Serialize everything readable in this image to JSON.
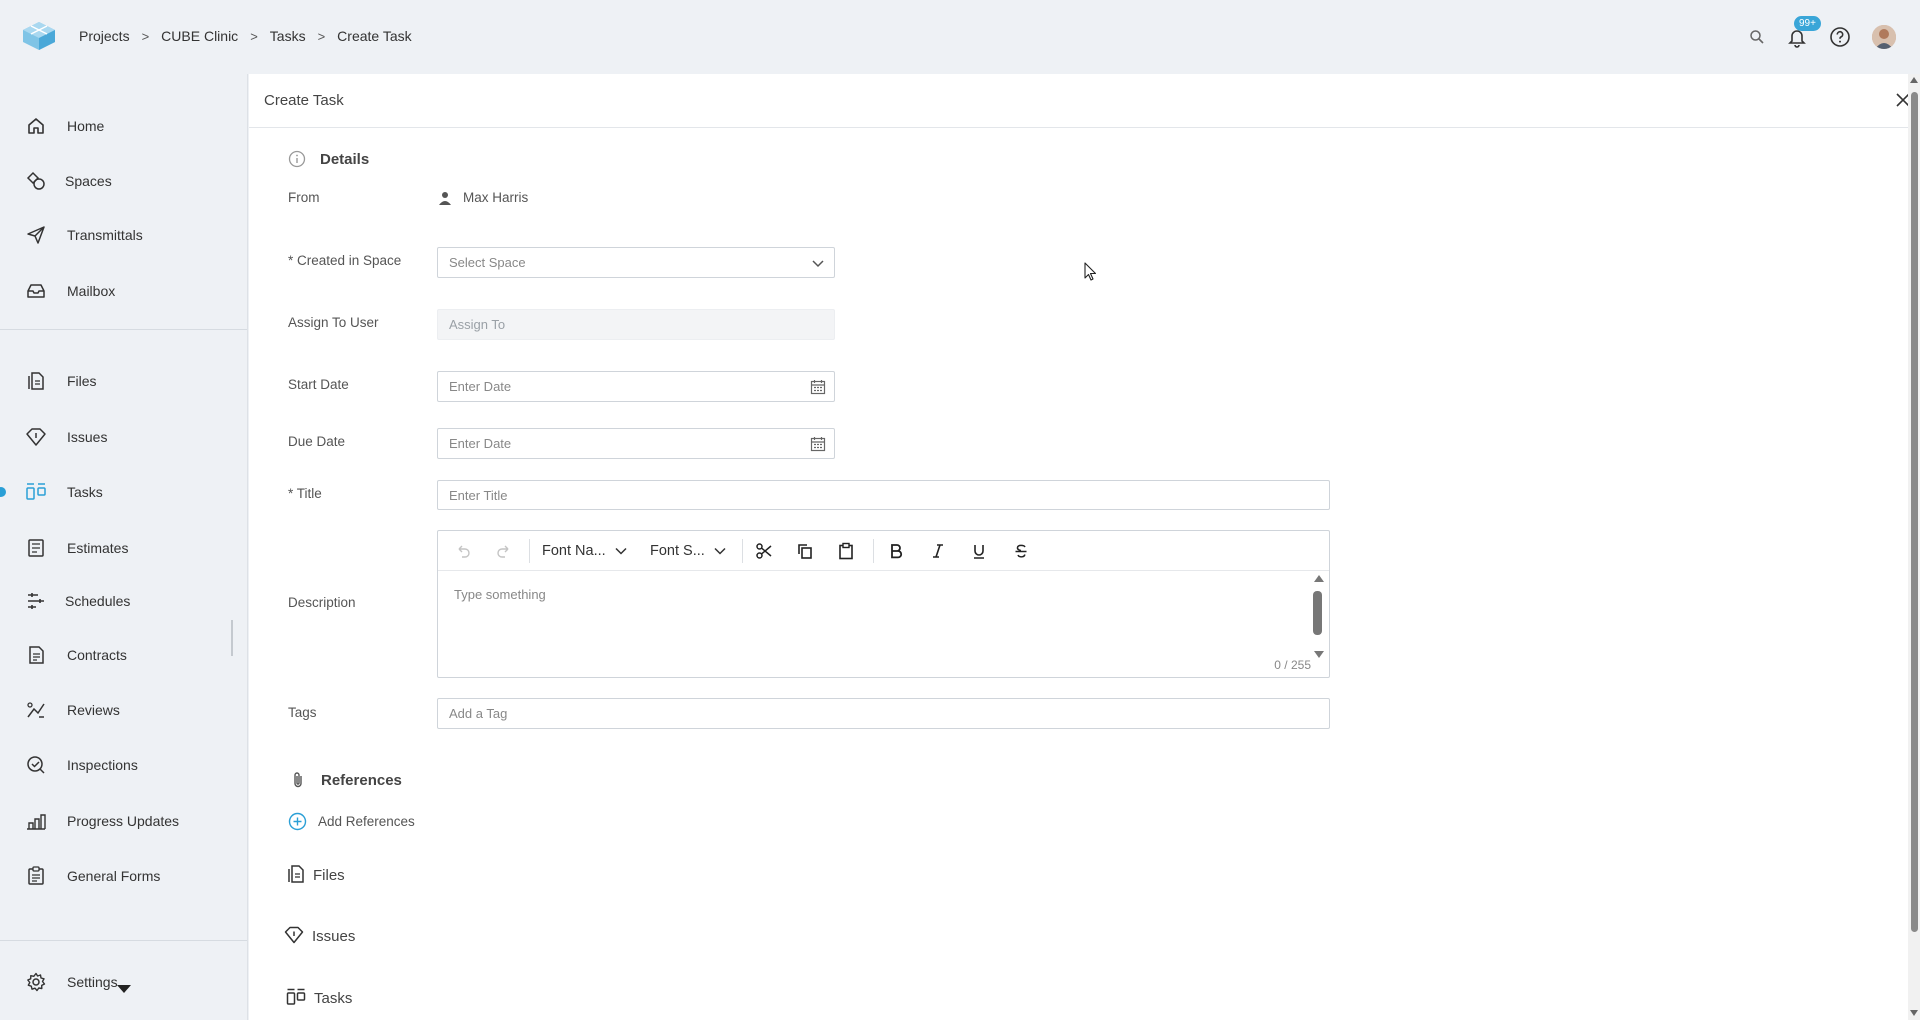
{
  "breadcrumb": [
    "Projects",
    "CUBE Clinic",
    "Tasks",
    "Create Task"
  ],
  "header": {
    "notification_badge": "99+",
    "icons": [
      "search-icon",
      "bell-icon",
      "help-icon",
      "avatar"
    ]
  },
  "sidebar": {
    "items": [
      {
        "label": "Home",
        "icon": "home-icon"
      },
      {
        "label": "Spaces",
        "icon": "spaces-icon"
      },
      {
        "label": "Transmittals",
        "icon": "send-icon"
      },
      {
        "label": "Mailbox",
        "icon": "mailbox-icon"
      },
      {
        "label": "Files",
        "icon": "files-icon"
      },
      {
        "label": "Issues",
        "icon": "issues-icon"
      },
      {
        "label": "Tasks",
        "icon": "tasks-icon"
      },
      {
        "label": "Estimates",
        "icon": "estimates-icon"
      },
      {
        "label": "Schedules",
        "icon": "schedules-icon"
      },
      {
        "label": "Contracts",
        "icon": "contracts-icon"
      },
      {
        "label": "Reviews",
        "icon": "reviews-icon"
      },
      {
        "label": "Inspections",
        "icon": "inspections-icon"
      },
      {
        "label": "Progress Updates",
        "icon": "progress-icon"
      },
      {
        "label": "General Forms",
        "icon": "forms-icon"
      }
    ],
    "settings_label": "Settings",
    "active": "Tasks"
  },
  "panel": {
    "title": "Create Task",
    "details_heading": "Details",
    "from_label": "From",
    "from_user": "Max Harris",
    "space_label": "* Created in Space",
    "space_placeholder": "Select Space",
    "assign_label": "Assign To User",
    "assign_placeholder": "Assign To",
    "start_label": "Start Date",
    "start_placeholder": "Enter Date",
    "due_label": "Due Date",
    "due_placeholder": "Enter Date",
    "title_label": "* Title",
    "title_placeholder": "Enter Title",
    "description_label": "Description",
    "editor": {
      "font_name": "Font Na...",
      "font_size": "Font S...",
      "placeholder": "Type something",
      "counter": "0 / 255"
    },
    "tags_label": "Tags",
    "tags_placeholder": "Add a Tag",
    "references_heading": "References",
    "add_references": "Add References",
    "reference_types": [
      "Files",
      "Issues",
      "Tasks"
    ]
  },
  "colors": {
    "accent": "#2a9fd6",
    "background": "#eef1f5",
    "badge": "#3aa6d8"
  }
}
